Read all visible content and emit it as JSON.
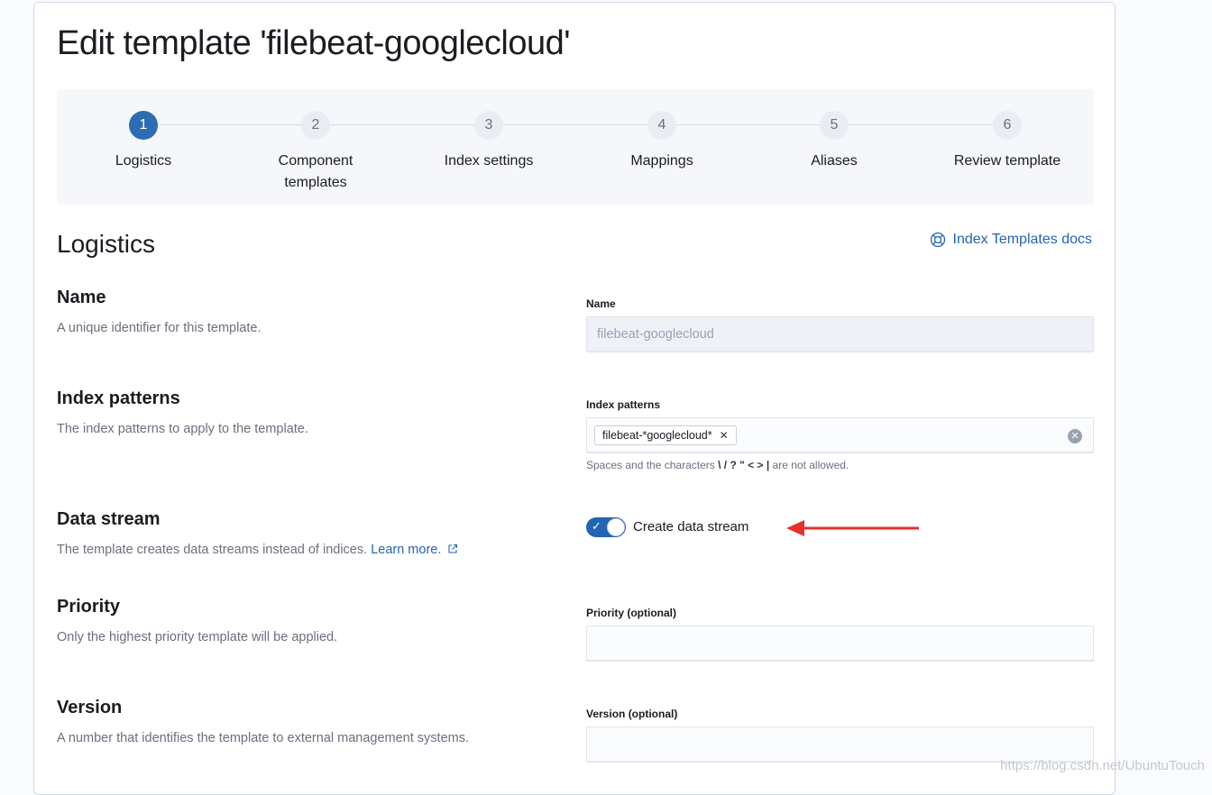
{
  "page": {
    "title": "Edit template 'filebeat-googlecloud'"
  },
  "stepper": {
    "steps": [
      {
        "num": "1",
        "title": "Logistics",
        "active": true
      },
      {
        "num": "2",
        "title": "Component templates",
        "active": false
      },
      {
        "num": "3",
        "title": "Index settings",
        "active": false
      },
      {
        "num": "4",
        "title": "Mappings",
        "active": false
      },
      {
        "num": "5",
        "title": "Aliases",
        "active": false
      },
      {
        "num": "6",
        "title": "Review template",
        "active": false
      }
    ]
  },
  "section": {
    "title": "Logistics",
    "docs_link": "Index Templates docs"
  },
  "name_row": {
    "title": "Name",
    "description": "A unique identifier for this template.",
    "field_label": "Name",
    "value": "filebeat-googlecloud"
  },
  "index_patterns_row": {
    "title": "Index patterns",
    "description": "The index patterns to apply to the template.",
    "field_label": "Index patterns",
    "chips": [
      "filebeat-*googlecloud*"
    ],
    "help_prefix": "Spaces and the characters",
    "help_chars": "\\ / ? \" < > |",
    "help_suffix": "are not allowed."
  },
  "data_stream_row": {
    "title": "Data stream",
    "description": "The template creates data streams instead of indices.",
    "learn_more": "Learn more.",
    "toggle_label": "Create data stream",
    "toggle_on": true
  },
  "priority_row": {
    "title": "Priority",
    "description": "Only the highest priority template will be applied.",
    "field_label": "Priority (optional)",
    "value": ""
  },
  "version_row": {
    "title": "Version",
    "description": "A number that identifies the template to external management systems.",
    "field_label": "Version (optional)",
    "value": ""
  },
  "watermark": "https://blog.csdn.net/UbuntuTouch",
  "colors": {
    "accent": "#2464b4",
    "annotation": "#e5322d"
  },
  "icons": {
    "docs": "lifebuoy-icon",
    "external": "external-link-icon",
    "chip_remove": "cross-icon",
    "clear": "clear-icon",
    "check": "check-icon"
  }
}
